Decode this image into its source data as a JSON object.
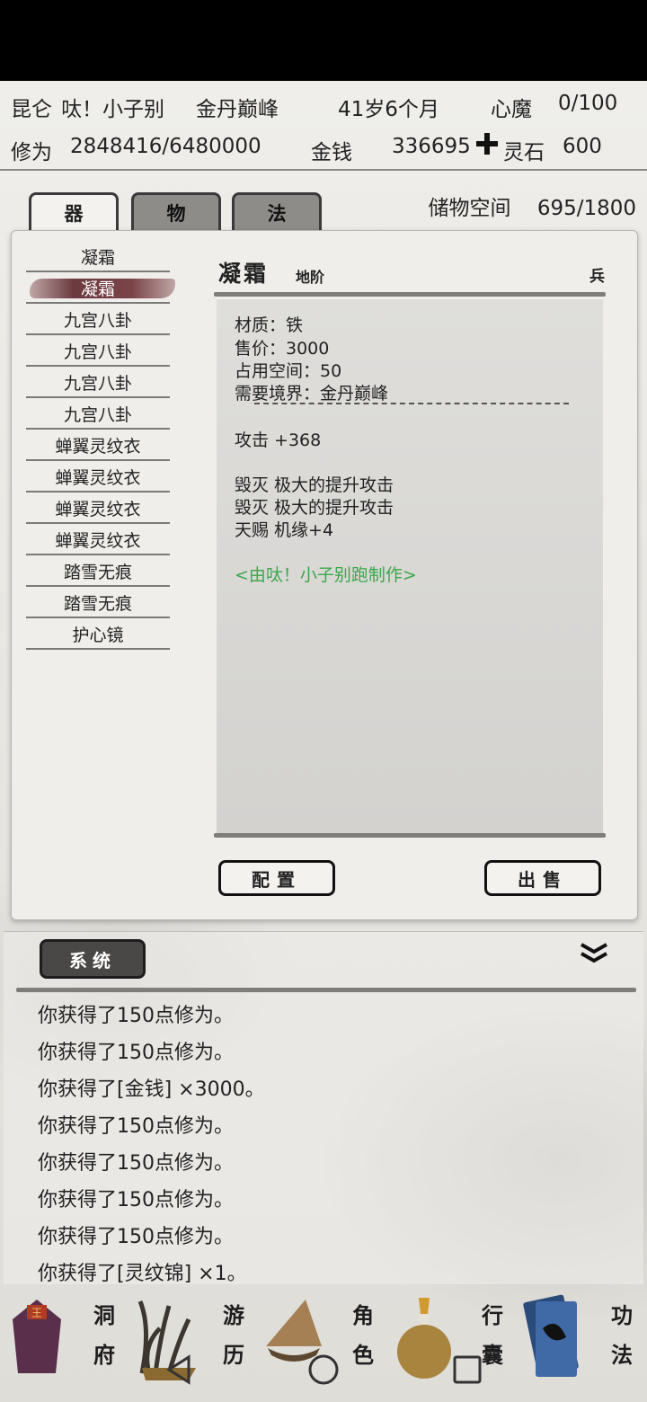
{
  "header": {
    "location": "昆仑",
    "player_name": "呔！小子别",
    "realm": "金丹巅峰",
    "age": "41岁6个月",
    "demon_label": "心魔",
    "demon_value": "0/100",
    "cultivation_label": "修为",
    "cultivation_value": "2848416/6480000",
    "money_label": "金钱",
    "money_value": "336695",
    "spirit_stone_label": "灵石",
    "spirit_stone_value": "600"
  },
  "tabs": [
    {
      "label": "器",
      "active": true
    },
    {
      "label": "物",
      "active": false
    },
    {
      "label": "法",
      "active": false
    }
  ],
  "storage": {
    "label": "储物空间",
    "value": "695/1800"
  },
  "items": [
    {
      "label": "凝霜",
      "selected": false
    },
    {
      "label": "凝霜",
      "selected": true
    },
    {
      "label": "九宫八卦",
      "selected": false
    },
    {
      "label": "九宫八卦",
      "selected": false
    },
    {
      "label": "九宫八卦",
      "selected": false
    },
    {
      "label": "九宫八卦",
      "selected": false
    },
    {
      "label": "蝉翼灵纹衣",
      "selected": false
    },
    {
      "label": "蝉翼灵纹衣",
      "selected": false
    },
    {
      "label": "蝉翼灵纹衣",
      "selected": false
    },
    {
      "label": "蝉翼灵纹衣",
      "selected": false
    },
    {
      "label": "踏雪无痕",
      "selected": false
    },
    {
      "label": "踏雪无痕",
      "selected": false
    },
    {
      "label": "护心镜",
      "selected": false
    }
  ],
  "detail": {
    "name": "凝霜",
    "grade": "地阶",
    "type": "兵",
    "material": "材质：铁",
    "price": "售价：3000",
    "space": "占用空间：50",
    "realm_req": "需要境界：金丹巅峰",
    "attack": "攻击 +368",
    "effect1": "毁灭 极大的提升攻击",
    "effect2": "毁灭 极大的提升攻击",
    "effect3": "天赐 机缘+4",
    "maker": "<由呔！小子别跑制作>"
  },
  "buttons": {
    "equip": "配置",
    "sell": "出售"
  },
  "log": {
    "tab_label": "系统",
    "lines": [
      "你获得了150点修为。",
      "你获得了150点修为。",
      "你获得了[金钱] ×3000。",
      "你获得了150点修为。",
      "你获得了150点修为。",
      "你获得了150点修为。",
      "你获得了150点修为。",
      "你获得了[灵纹锦] ×1。"
    ]
  },
  "nav": [
    {
      "top": "洞",
      "bottom": "府",
      "art": "house-icon"
    },
    {
      "top": "游",
      "bottom": "历",
      "art": "grass-icon"
    },
    {
      "top": "角",
      "bottom": "色",
      "art": "hat-icon"
    },
    {
      "top": "行",
      "bottom": "囊",
      "art": "bag-icon"
    },
    {
      "top": "功",
      "bottom": "法",
      "art": "book-icon"
    }
  ],
  "colors": {
    "accent_green": "#3aa64a",
    "selected_item": "#6b3a3f"
  }
}
